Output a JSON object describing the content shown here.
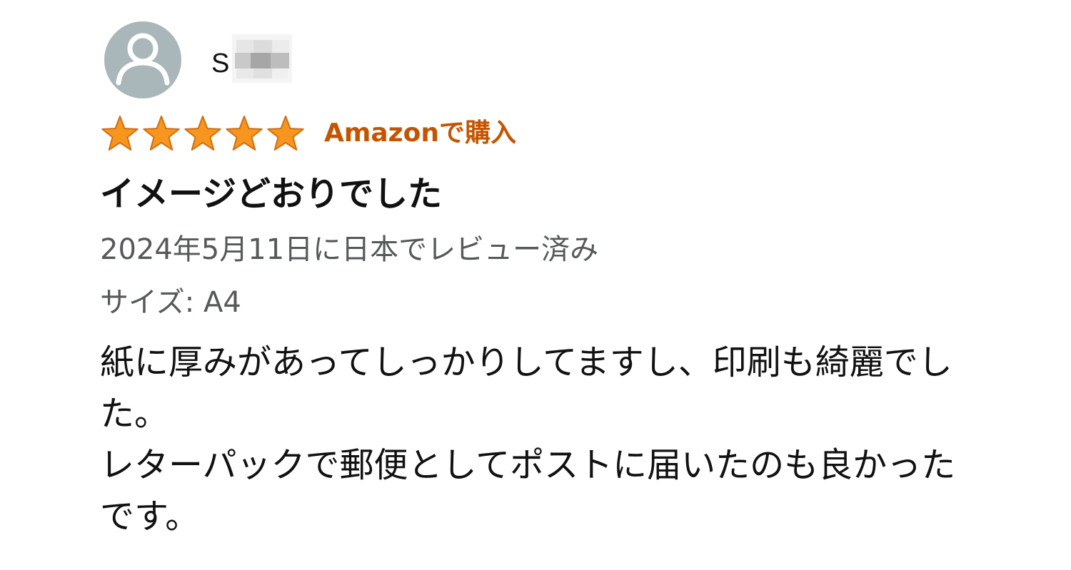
{
  "reviewer": {
    "name": "S",
    "avatar_icon": "default-user-icon",
    "avatar_color": "#a9b7bb"
  },
  "rating": {
    "stars": 5,
    "max_stars": 5,
    "star_icon": "star-icon",
    "star_color": "#f7961e"
  },
  "verified_badge": {
    "label": "Amazonで購入",
    "color": "#c45500"
  },
  "review": {
    "title": "イメージどおりでした",
    "date_text": "2024年5月11日に日本でレビュー済み",
    "variant_text": "サイズ: A4",
    "body_lines": [
      "紙に厚みがあってしっかりしてますし、印刷も綺麗でした。",
      "レターパックで郵便としてポストに届いたのも良かったです。"
    ]
  }
}
